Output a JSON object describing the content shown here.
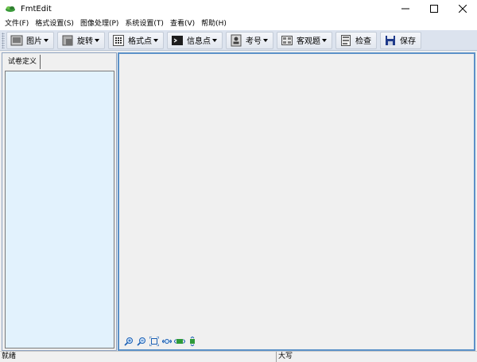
{
  "window": {
    "title": "FmtEdit"
  },
  "menu": [
    "文件(F)",
    "格式设置(S)",
    "图像处理(P)",
    "系统设置(T)",
    "查看(V)",
    "帮助(H)"
  ],
  "toolbar": {
    "picture": "图片",
    "rotate": "旋转",
    "format_points": "格式点",
    "info_points": "信息点",
    "exam_number": "考号",
    "objective": "客观题",
    "check": "检查",
    "save": "保存"
  },
  "left_panel": {
    "tab": "试卷定义"
  },
  "status": {
    "main": "就绪",
    "caps": "大写"
  }
}
